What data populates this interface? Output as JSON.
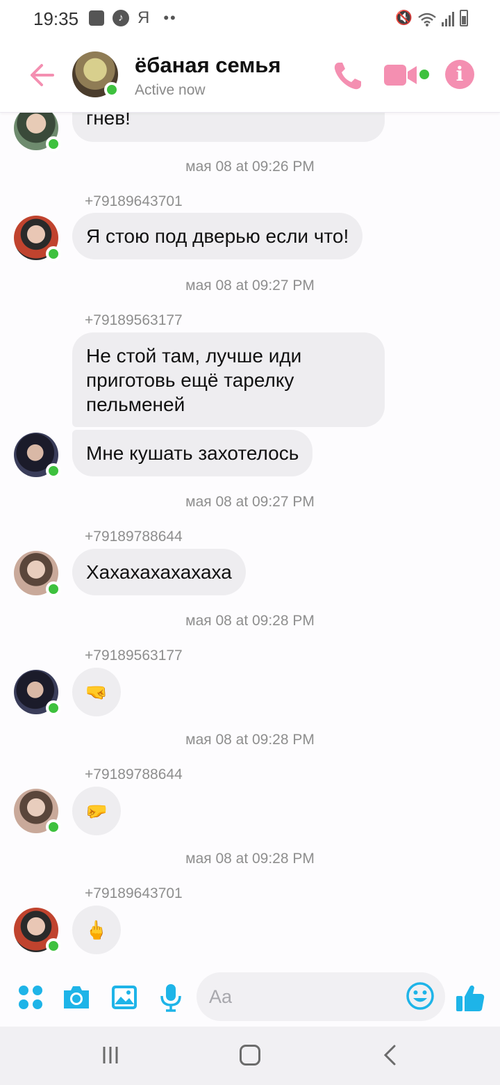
{
  "status_bar": {
    "time": "19:35",
    "carrier_letter": "Я",
    "dots": "••"
  },
  "header": {
    "title": "ёбаная семья",
    "status": "Active now",
    "accent_color": "#f48fb1",
    "online_color": "#3ec13e"
  },
  "messages": {
    "partial_bubble_text": "гнев!",
    "groups": [
      {
        "timestamp": "мая 08 at 09:26 PM",
        "sender": "+79189643701",
        "bubbles": [
          "Я стою под дверью если что!"
        ]
      },
      {
        "timestamp": "мая 08 at 09:27 PM",
        "sender": "+79189563177",
        "bubbles": [
          "Не стой там, лучше иди приготовь ещё тарелку пельменей",
          "Мне кушать захотелось"
        ]
      },
      {
        "timestamp": "мая 08 at 09:27 PM",
        "sender": "+79189788644",
        "bubbles": [
          "Хахахахахахаха"
        ]
      },
      {
        "timestamp": "мая 08 at 09:28 PM",
        "sender": "+79189563177",
        "bubbles": [
          "🤜"
        ]
      },
      {
        "timestamp": "мая 08 at 09:28 PM",
        "sender": "+79189788644",
        "bubbles": [
          "🤛"
        ]
      },
      {
        "timestamp": "мая 08 at 09:28 PM",
        "sender": "+79189643701",
        "bubbles": [
          "🖕"
        ]
      }
    ]
  },
  "composer": {
    "placeholder": "Aa",
    "icon_color": "#1eb4e8",
    "icons": [
      "apps-icon",
      "camera-icon",
      "gallery-icon",
      "microphone-icon",
      "emoji-icon",
      "thumbs-up-icon"
    ]
  },
  "nav": {
    "icons": [
      "recent-apps-icon",
      "home-icon",
      "back-icon"
    ]
  }
}
